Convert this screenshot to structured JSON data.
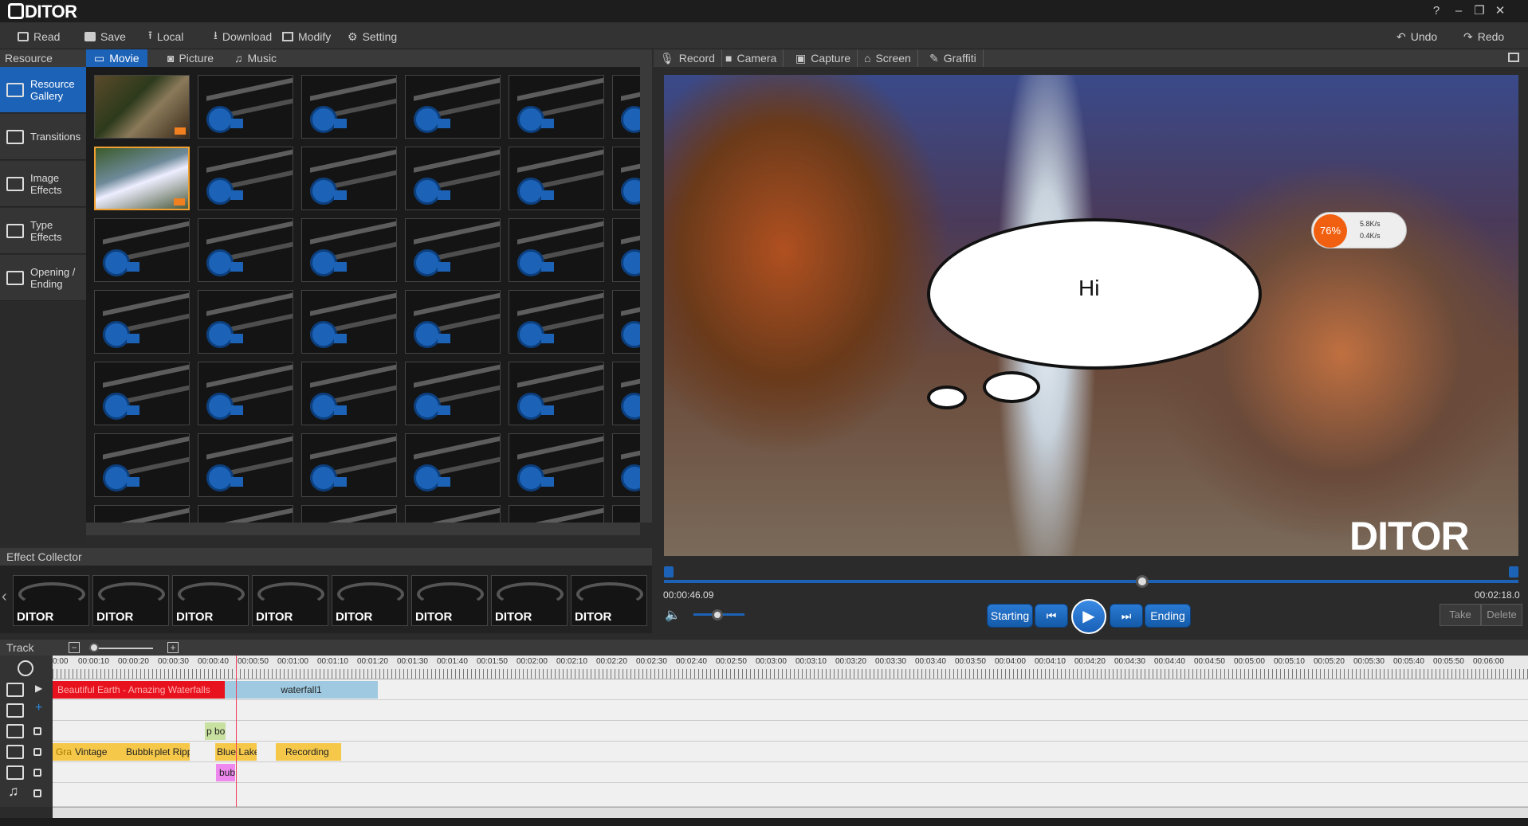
{
  "app": {
    "title": "DITOR",
    "watermark": "DITOR"
  },
  "window": {
    "help": "?",
    "minimize": "–",
    "restore": "❐",
    "close": "✕"
  },
  "toolbar": {
    "read": "Read",
    "save": "Save",
    "local": "Local",
    "download": "Download",
    "modify": "Modify",
    "setting": "Setting",
    "undo": "Undo",
    "redo": "Redo"
  },
  "sidebar": {
    "header": "Resource",
    "items": [
      {
        "label": "Resource Gallery"
      },
      {
        "label": "Transitions"
      },
      {
        "label": "Image Effects"
      },
      {
        "label": "Type Effects"
      },
      {
        "label": "Opening / Ending"
      }
    ]
  },
  "gallery_tabs": [
    {
      "label": "Movie"
    },
    {
      "label": "Picture"
    },
    {
      "label": "Music"
    }
  ],
  "effect_collector": {
    "header": "Effect Collector",
    "item_label": "DITOR"
  },
  "record_tabs": [
    {
      "label": "Record"
    },
    {
      "label": "Camera"
    },
    {
      "label": "Capture"
    },
    {
      "label": "Screen"
    },
    {
      "label": "Graffiti"
    }
  ],
  "preview": {
    "bubble_text": "Hi",
    "net_percent": "76%",
    "net_up": "5.8K/s",
    "net_down": "0.4K/s"
  },
  "playback": {
    "position_fraction": 0.56,
    "current_time": "00:00:46.09",
    "total_time": "00:02:18.0",
    "starting": "Starting",
    "ending": "Ending",
    "take": "Take",
    "delete": "Delete"
  },
  "track": {
    "header": "Track",
    "ruler": [
      "0:00",
      "00:00:10",
      "00:00:20",
      "00:00:30",
      "00:00:40",
      "00:00:50",
      "00:01:00",
      "00:01:10",
      "00:01:20",
      "00:01:30",
      "00:01:40",
      "00:01:50",
      "00:02:00",
      "00:02:10",
      "00:02:20",
      "00:02:30",
      "00:02:40",
      "00:02:50",
      "00:03:00",
      "00:03:10",
      "00:03:20",
      "00:03:30",
      "00:03:40",
      "00:03:50",
      "00:04:00",
      "00:04:10",
      "00:04:20",
      "00:04:30",
      "00:04:40",
      "00:04:50",
      "00:05:00",
      "00:05:10",
      "00:05:20",
      "00:05:30",
      "00:05:40",
      "00:05:50",
      "00:06:00"
    ],
    "video_clips": [
      "Beautiful Earth - Amazing Waterfalls",
      "waterfall1"
    ],
    "transition_clips": [
      "p bo"
    ],
    "effect_clips": [
      "Graffiti",
      "Vintage",
      "Bubble",
      "plet Ripp",
      "Blue Lake",
      "Recording"
    ],
    "type_clips": [
      "bub"
    ]
  },
  "colors": {
    "accent": "#1c63b8",
    "video_red": "#e8121e",
    "video_blue": "#9ec9e0",
    "effect_yellow": "#f5c84a",
    "type_pink": "#ee88ee"
  }
}
